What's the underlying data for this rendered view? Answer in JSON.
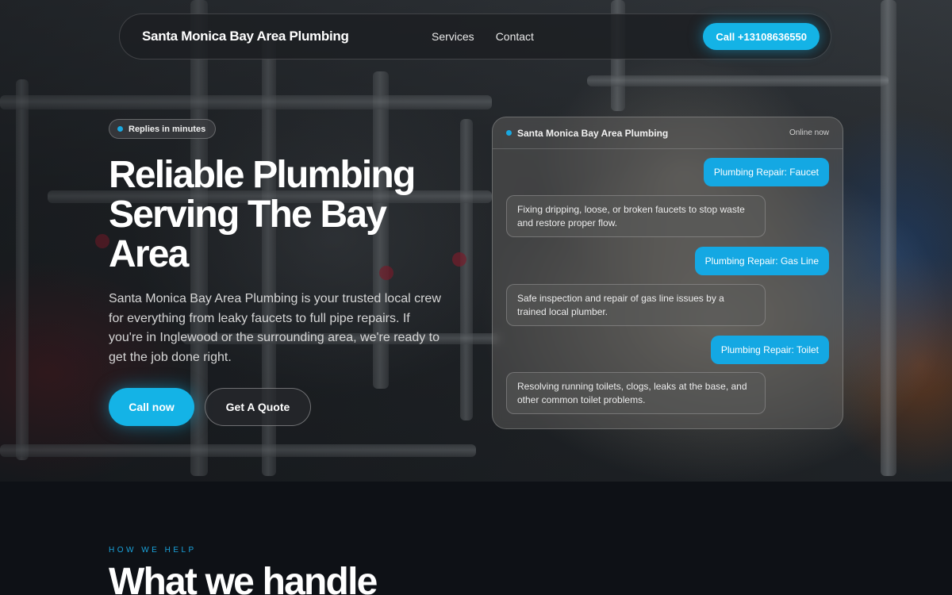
{
  "nav": {
    "brand": "Santa Monica Bay Area Plumbing",
    "links": [
      "Services",
      "Contact"
    ],
    "call_label": "Call +13108636550"
  },
  "hero": {
    "badge": "Replies in minutes",
    "headline": "Reliable Plumbing Serving The Bay Area",
    "subtext": "Santa Monica Bay Area Plumbing is your trusted local crew for everything from leaky faucets to full pipe repairs. If you're in Inglewood or the surrounding area, we're ready to get the job done right.",
    "primary_cta": "Call now",
    "secondary_cta": "Get A Quote"
  },
  "chat": {
    "title": "Santa Monica Bay Area Plumbing",
    "status": "Online now",
    "messages": [
      {
        "from": "user",
        "text": "Plumbing Repair: Faucet"
      },
      {
        "from": "business",
        "text": "Fixing dripping, loose, or broken faucets to stop waste and restore proper flow."
      },
      {
        "from": "user",
        "text": "Plumbing Repair: Gas Line"
      },
      {
        "from": "business",
        "text": "Safe inspection and repair of gas line issues by a trained local plumber."
      },
      {
        "from": "user",
        "text": "Plumbing Repair: Toilet"
      },
      {
        "from": "business",
        "text": "Resolving running toilets, clogs, leaks at the base, and other common toilet problems."
      }
    ]
  },
  "section": {
    "kicker": "HOW WE HELP",
    "title": "What we handle"
  },
  "colors": {
    "accent": "#14b3e6",
    "background": "#0e1116"
  }
}
